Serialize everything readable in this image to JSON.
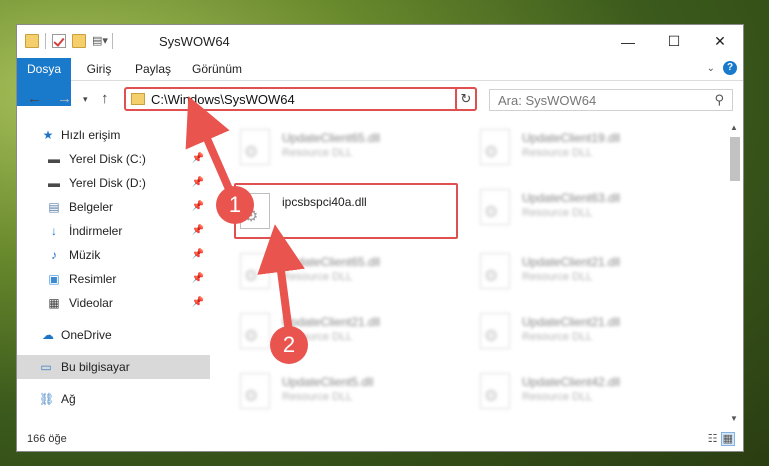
{
  "window": {
    "title": "SysWOW64"
  },
  "ribbon": {
    "tabs": [
      "Dosya",
      "Giriş",
      "Paylaş",
      "Görünüm"
    ]
  },
  "nav": {
    "address": "C:\\Windows\\SysWOW64",
    "search_placeholder": "Ara: SysWOW64"
  },
  "sidebar": {
    "quick_access": "Hızlı erişim",
    "items": [
      {
        "label": "Yerel Disk (C:)",
        "icon": "drive-icon"
      },
      {
        "label": "Yerel Disk (D:)",
        "icon": "drive-icon"
      },
      {
        "label": "Belgeler",
        "icon": "documents-icon"
      },
      {
        "label": "İndirmeler",
        "icon": "download-icon"
      },
      {
        "label": "Müzik",
        "icon": "music-icon"
      },
      {
        "label": "Resimler",
        "icon": "pictures-icon"
      },
      {
        "label": "Videolar",
        "icon": "videos-icon"
      }
    ],
    "onedrive": "OneDrive",
    "this_pc": "Bu bilgisayar",
    "network": "Ağ"
  },
  "files": {
    "highlighted": {
      "name": "ipcsbspci40a.dll"
    },
    "left_column": [
      {
        "name": "UpdateClient65.dll",
        "type": "Resource DLL"
      },
      {
        "name": "UpdateClient65.dll",
        "type": "Resource DLL"
      },
      {
        "name": "UpdateClient21.dll",
        "type": "Resource DLL"
      },
      {
        "name": "UpdateClient5.dll",
        "type": "Resource DLL"
      }
    ],
    "right_column": [
      {
        "name": "UpdateClient19.dll",
        "type": "Resource DLL"
      },
      {
        "name": "UpdateClient63.dll",
        "type": "Resource DLL"
      },
      {
        "name": "UpdateClient21.dll",
        "type": "Resource DLL"
      },
      {
        "name": "UpdateClient21.dll",
        "type": "Resource DLL"
      },
      {
        "name": "UpdateClient42.dll",
        "type": "Resource DLL"
      }
    ]
  },
  "status": {
    "count": "166 öğe"
  },
  "annotations": {
    "step1": "1",
    "step2": "2",
    "color": "#e9544f"
  }
}
